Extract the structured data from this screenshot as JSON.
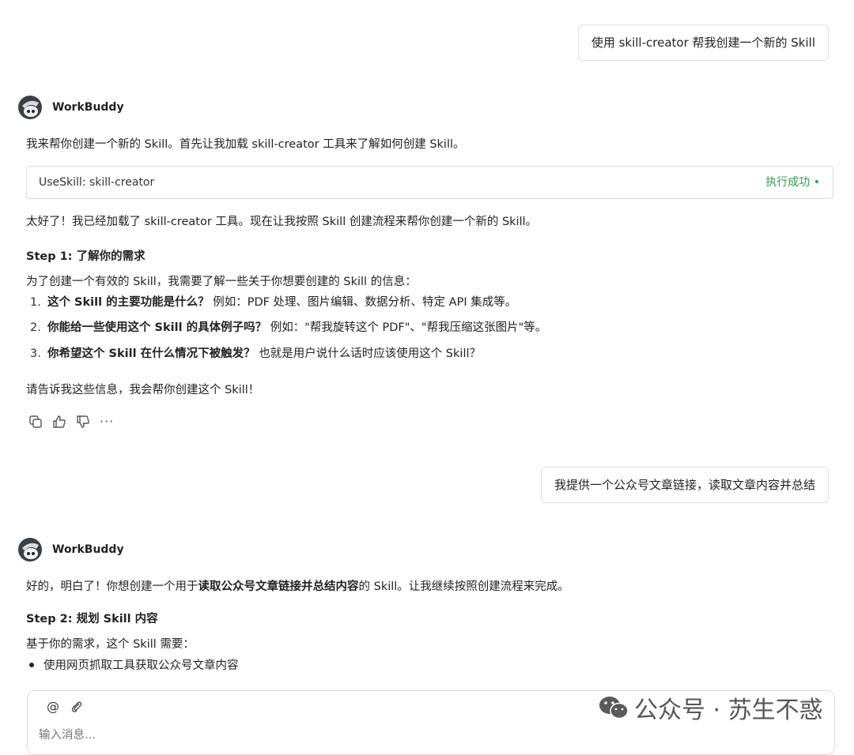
{
  "messages": {
    "user1": "使用 skill-creator 帮我创建一个新的 Skill",
    "user2": "我提供一个公众号文章链接，读取文章内容并总结"
  },
  "bot": {
    "name": "WorkBuddy",
    "msg1_intro": "我来帮你创建一个新的 Skill。首先让我加载 skill-creator 工具来了解如何创建 Skill。",
    "tool_call": {
      "name": "UseSkill: skill-creator",
      "status": "执行成功 •"
    },
    "msg1_after": "太好了！我已经加载了 skill-creator 工具。现在让我按照 Skill 创建流程来帮你创建一个新的 Skill。",
    "step1_title": "Step 1: 了解你的需求",
    "step1_desc": "为了创建一个有效的 Skill，我需要了解一些关于你想要创建的 Skill 的信息：",
    "step1_items": [
      {
        "num": "1.",
        "q": "这个 Skill 的主要功能是什么？",
        "detail": "例如：PDF 处理、图片编辑、数据分析、特定 API 集成等。"
      },
      {
        "num": "2.",
        "q": "你能给一些使用这个 Skill 的具体例子吗？",
        "detail": "例如：\"帮我旋转这个 PDF\"、\"帮我压缩这张图片\"等。"
      },
      {
        "num": "3.",
        "q": "你希望这个 Skill 在什么情况下被触发？",
        "detail": "也就是用户说什么话时应该使用这个 Skill？"
      }
    ],
    "msg1_end": "请告诉我这些信息，我会帮你创建这个 Skill！",
    "more_glyph": "···",
    "msg2_pre": "好的，明白了！你想创建一个用于",
    "msg2_bold": "读取公众号文章链接并总结内容",
    "msg2_post": "的 Skill。让我继续按照创建流程来完成。",
    "step2_title": "Step 2: 规划 Skill 内容",
    "step2_desc": "基于你的需求，这个 Skill 需要：",
    "step2_items": [
      "使用网页抓取工具获取公众号文章内容"
    ]
  },
  "composer": {
    "mention_glyph": "@",
    "placeholder": "输入消息..."
  },
  "watermark": "公众号 · 苏生不惑",
  "icons": [
    "robot-avatar-icon",
    "copy-icon",
    "thumbs-up-icon",
    "thumbs-down-icon",
    "more-icon",
    "mention-icon",
    "paperclip-icon",
    "wechat-icon"
  ],
  "colors": {
    "success": "#2e9e4a",
    "border": "#dcdcdc"
  }
}
